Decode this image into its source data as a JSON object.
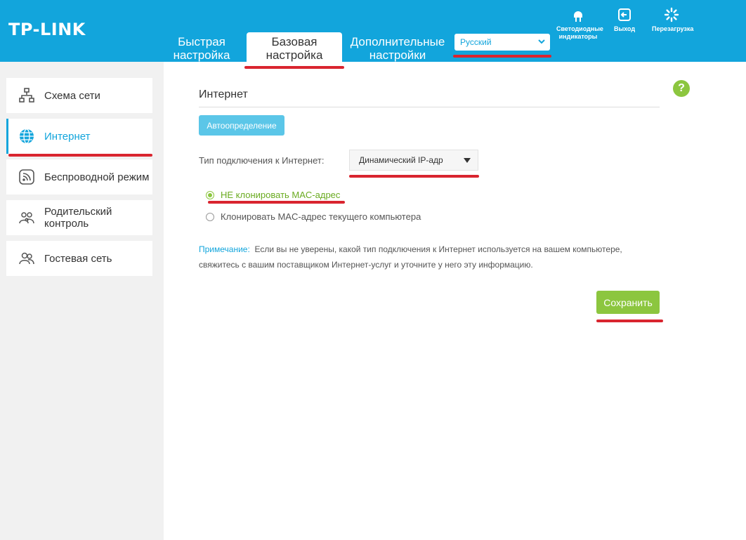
{
  "header": {
    "logo": "TP-LINK",
    "tabs": {
      "quick": "Быстрая настройка",
      "basic": "Базовая настройка",
      "advanced": "Дополнительные настройки"
    },
    "language": "Русский",
    "buttons": {
      "led": "Светодиодные индикаторы",
      "logout": "Выход",
      "reboot": "Перезагрузка"
    }
  },
  "sidebar": {
    "items": [
      {
        "label": "Схема сети"
      },
      {
        "label": "Интернет"
      },
      {
        "label": "Беспроводной режим"
      },
      {
        "label": "Родительский контроль"
      },
      {
        "label": "Гостевая сеть"
      }
    ]
  },
  "main": {
    "title": "Интернет",
    "auto_detect": "Автоопределение",
    "connection_type_label": "Тип подключения к Интернет:",
    "connection_type_value": "Динамический IP-адр",
    "radio_no_clone": "НЕ клонировать MAC-адрес",
    "radio_clone": "Клонировать MAC-адрес текущего компьютера",
    "note_prefix": "Примечание:",
    "note_text": "Если вы не уверены, какой тип подключения к Интернет используется на вашем компьютере, свяжитесь с вашим поставщиком Интернет-услуг и уточните у него эту информацию.",
    "save": "Сохранить",
    "help": "?"
  },
  "colors": {
    "header_blue": "#12a5dc",
    "accent_green": "#8cc63f",
    "annotation_red": "#d9252f"
  }
}
